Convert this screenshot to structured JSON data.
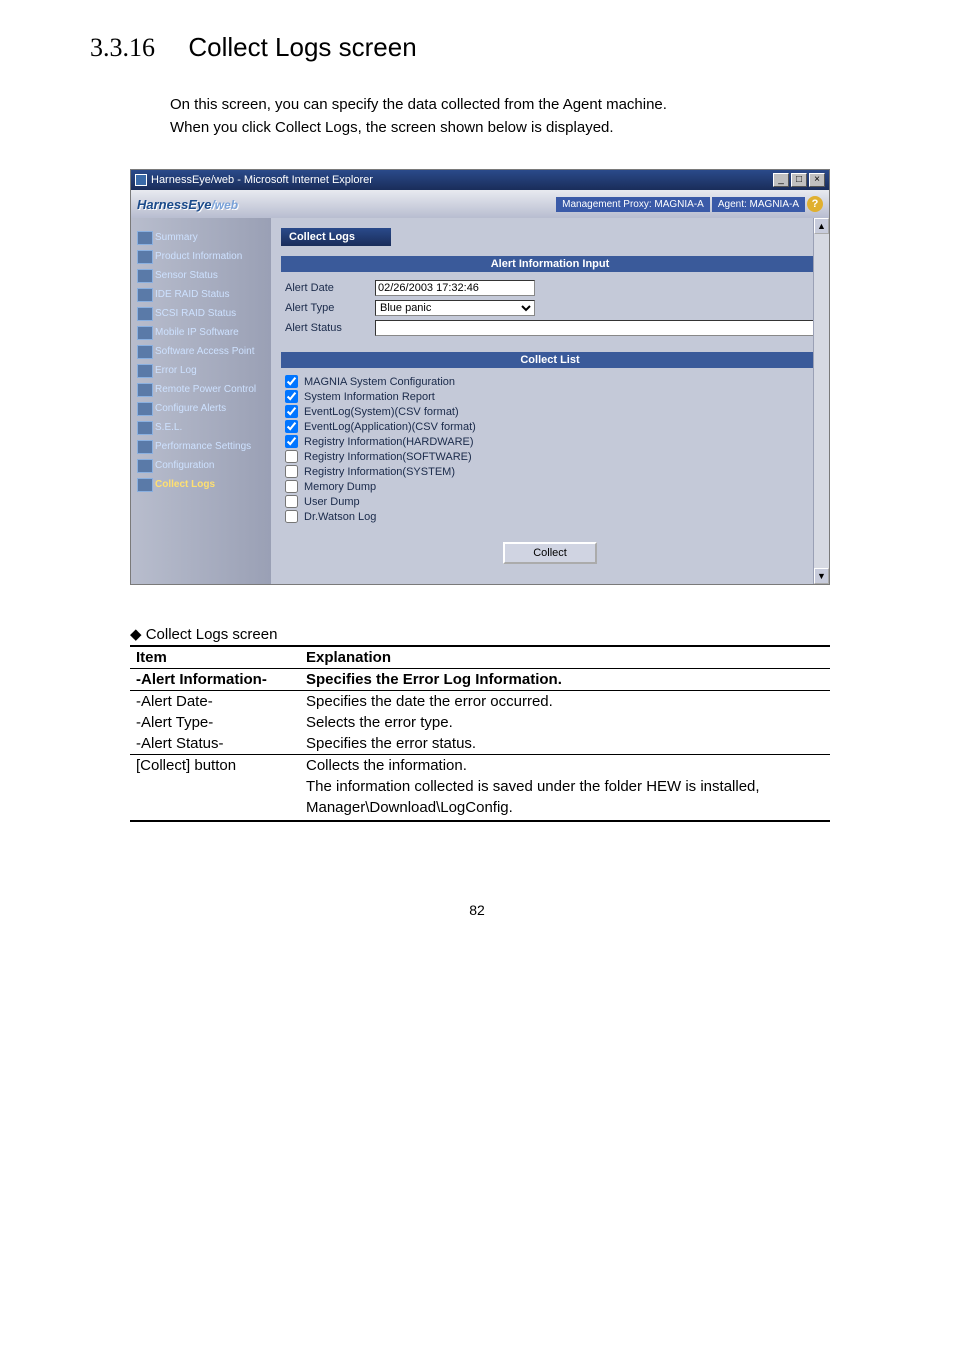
{
  "section": {
    "number": "3.3.16",
    "title": "Collect Logs screen"
  },
  "intro": {
    "line1": "On this screen, you can specify the data collected from the Agent machine.",
    "line2": "When you click Collect Logs, the screen shown below is displayed."
  },
  "shot": {
    "window_title": "HarnessEye/web - Microsoft Internet Explorer",
    "brand_main": "HarnessEye",
    "brand_sub": "/web",
    "proxy_label": "Management Proxy: MAGNIA-A",
    "agent_label": "Agent: MAGNIA-A",
    "sidebar": {
      "items": [
        {
          "label": "Summary"
        },
        {
          "label": "Product Information"
        },
        {
          "label": "Sensor Status"
        },
        {
          "label": "IDE RAID Status"
        },
        {
          "label": "SCSI RAID Status"
        },
        {
          "label": "Mobile IP Software"
        },
        {
          "label": "Software Access Point"
        },
        {
          "label": "Error Log"
        },
        {
          "label": "Remote Power Control"
        },
        {
          "label": "Configure Alerts"
        },
        {
          "label": "S.E.L."
        },
        {
          "label": "Performance Settings"
        },
        {
          "label": "Configuration"
        },
        {
          "label": "Collect Logs"
        }
      ]
    },
    "panel_title": "Collect Logs",
    "alert_info_head": "Alert Information Input",
    "alert_date_label": "Alert Date",
    "alert_date_value": "02/26/2003 17:32:46",
    "alert_type_label": "Alert Type",
    "alert_type_value": "Blue panic",
    "alert_status_label": "Alert Status",
    "collect_list_head": "Collect List",
    "collect_items": [
      {
        "label": "MAGNIA System Configuration",
        "checked": true
      },
      {
        "label": "System Information Report",
        "checked": true
      },
      {
        "label": "EventLog(System)(CSV format)",
        "checked": true
      },
      {
        "label": "EventLog(Application)(CSV format)",
        "checked": true
      },
      {
        "label": "Registry Information(HARDWARE)",
        "checked": true
      },
      {
        "label": "Registry Information(SOFTWARE)",
        "checked": false
      },
      {
        "label": "Registry Information(SYSTEM)",
        "checked": false
      },
      {
        "label": "Memory Dump",
        "checked": false
      },
      {
        "label": "User Dump",
        "checked": false
      },
      {
        "label": "Dr.Watson Log",
        "checked": false
      }
    ],
    "collect_button": "Collect"
  },
  "table": {
    "caption_prefix": "◆ ",
    "caption": "Collect Logs screen",
    "head_item": "Item",
    "head_expl": "Explanation",
    "rows": [
      {
        "item": "-Alert Information-",
        "expl": "Specifies the Error Log Information.",
        "bold": true,
        "hr": true
      },
      {
        "item": "-Alert Date-",
        "expl": "Specifies the date the error occurred.",
        "hr": true
      },
      {
        "item": "-Alert Type-",
        "expl": "Selects the error type."
      },
      {
        "item": "-Alert Status-",
        "expl": "Specifies the error status."
      },
      {
        "item": "[Collect] button",
        "expl": "Collects the information.",
        "hr": true
      },
      {
        "item": "",
        "expl": "The information collected is saved under the folder HEW is installed,"
      },
      {
        "item": "",
        "expl": "Manager\\Download\\LogConfig."
      }
    ]
  },
  "page_number": "82"
}
